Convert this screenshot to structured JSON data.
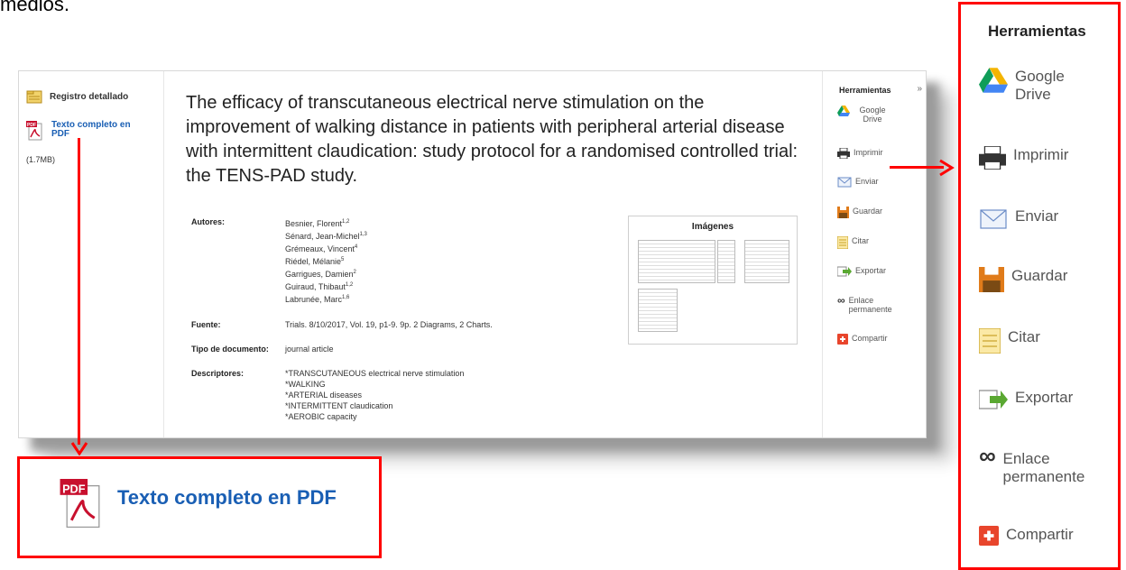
{
  "caption": "medios.",
  "left_column": {
    "detailed_record_label": "Registro detallado",
    "pdf_label": "Texto completo en PDF",
    "pdf_size": "(1.7MB)"
  },
  "article": {
    "title": "The efficacy of transcutaneous electrical nerve stimulation on the improvement of walking distance in patients with peripheral arterial disease with intermittent claudication: study protocol for a randomised controlled trial: the TENS-PAD study.",
    "authors_label": "Autores:",
    "authors": [
      {
        "name": "Besnier, Florent",
        "sup": "1,2"
      },
      {
        "name": "Sénard, Jean-Michel",
        "sup": "1,3"
      },
      {
        "name": "Grémeaux, Vincent",
        "sup": "4"
      },
      {
        "name": "Riédel, Mélanie",
        "sup": "5"
      },
      {
        "name": "Garrigues, Damien",
        "sup": "2"
      },
      {
        "name": "Guiraud, Thibaut",
        "sup": "1,2"
      },
      {
        "name": "Labrunée, Marc",
        "sup": "1,6"
      }
    ],
    "source_label": "Fuente:",
    "source": "Trials. 8/10/2017, Vol. 19, p1-9. 9p. 2 Diagrams, 2 Charts.",
    "doctype_label": "Tipo de documento:",
    "doctype": "journal article",
    "descriptors_label": "Descriptores:",
    "descriptors": [
      "*TRANSCUTANEOUS electrical nerve stimulation",
      "*WALKING",
      "*ARTERIAL diseases",
      "*INTERMITTENT claudication",
      "*AEROBIC capacity"
    ],
    "images_title": "Imágenes"
  },
  "tools": {
    "title": "Herramientas",
    "collapse": "»",
    "items": [
      {
        "label": "Google Drive",
        "icon": "google-drive-icon"
      },
      {
        "label": "Imprimir",
        "icon": "printer-icon"
      },
      {
        "label": "Enviar",
        "icon": "email-icon"
      },
      {
        "label": "Guardar",
        "icon": "save-icon"
      },
      {
        "label": "Citar",
        "icon": "cite-icon"
      },
      {
        "label": "Exportar",
        "icon": "export-icon"
      },
      {
        "label": "Enlace permanente",
        "icon": "link-icon"
      },
      {
        "label": "Compartir",
        "icon": "share-icon"
      }
    ]
  },
  "zoom_tools": {
    "title": "Herramientas",
    "items": [
      "Google Drive",
      "Imprimir",
      "Enviar",
      "Guardar",
      "Citar",
      "Exportar",
      "Enlace permanente",
      "Compartir"
    ]
  },
  "zoom_pdf": {
    "label": "Texto completo en PDF"
  },
  "colors": {
    "highlight": "#ff0000",
    "link": "#1a5fb4",
    "drive_green": "#0f9d58",
    "drive_yellow": "#f4b400",
    "drive_blue": "#4285f4",
    "share_red": "#e8452c",
    "save_orange": "#e07b1a"
  }
}
